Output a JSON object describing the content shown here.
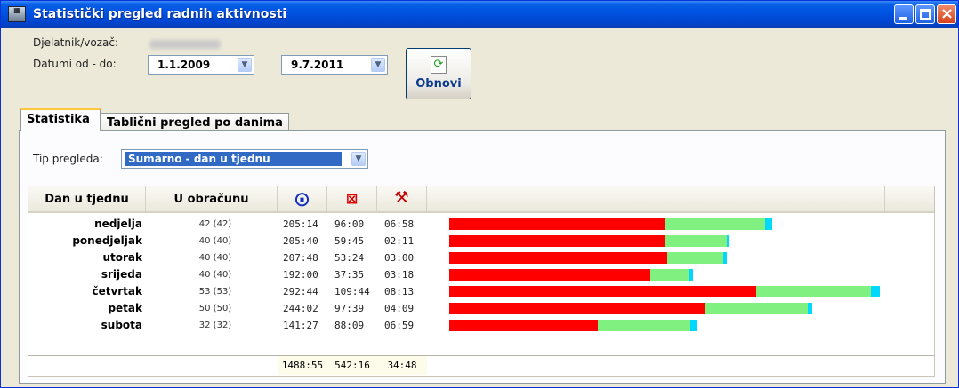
{
  "window": {
    "title": "Statistički pregled radnih aktivnosti",
    "icon": "app-logo-icon"
  },
  "header": {
    "driver_label": "Djelatnik/vozač:",
    "dates_label": "Datumi od - do:",
    "date_from": "1.1.2009",
    "date_to": "9.7.2011",
    "refresh_label": "Obnovi"
  },
  "tabs": [
    {
      "label": "Statistika",
      "active": true
    },
    {
      "label": "Tablični pregled po danima",
      "active": false
    }
  ],
  "filter": {
    "label": "Tip pregleda:",
    "value": "Sumarno - dan u tjednu"
  },
  "table": {
    "columns": {
      "day": "Dan u tjednu",
      "count": "U obračunu",
      "driving_icon": "steering-wheel-icon",
      "availability_icon": "availability-icon",
      "work_icon": "tools-icon"
    },
    "colors": {
      "driving": "#ff0000",
      "availability": "#80f080",
      "work": "#00d8ff"
    },
    "rows": [
      {
        "day": "nedjelja",
        "count": "42 (42)",
        "driving": "205:14",
        "availability": "96:00",
        "work": "06:58"
      },
      {
        "day": "ponedjeljak",
        "count": "40 (40)",
        "driving": "205:40",
        "availability": "59:45",
        "work": "02:11"
      },
      {
        "day": "utorak",
        "count": "40 (40)",
        "driving": "207:48",
        "availability": "53:24",
        "work": "03:00"
      },
      {
        "day": "srijeda",
        "count": "40 (40)",
        "driving": "192:00",
        "availability": "37:35",
        "work": "03:18"
      },
      {
        "day": "četvrtak",
        "count": "53 (53)",
        "driving": "292:44",
        "availability": "109:44",
        "work": "08:13"
      },
      {
        "day": "petak",
        "count": "50 (50)",
        "driving": "244:02",
        "availability": "97:39",
        "work": "04:09"
      },
      {
        "day": "subota",
        "count": "32 (32)",
        "driving": "141:27",
        "availability": "88:09",
        "work": "06:59"
      }
    ],
    "totals": {
      "driving": "1488:55",
      "availability": "542:16",
      "work": "34:48"
    }
  }
}
